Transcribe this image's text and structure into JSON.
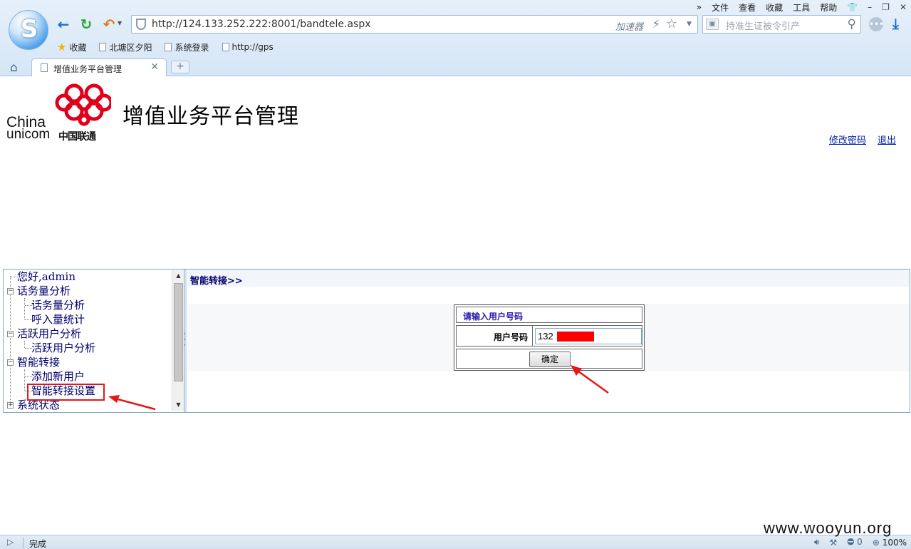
{
  "browser": {
    "menu": [
      "文件",
      "查看",
      "收藏",
      "工具",
      "帮助"
    ],
    "menu_expand": "»",
    "address_url": "http://124.133.252.222:8001/bandtele.aspx",
    "accelerator_label": "加速器",
    "search_placeholder": "持准生证被令引产",
    "favorites": [
      {
        "label": "收藏",
        "icon": "star-icon"
      },
      {
        "label": "北塘区夕阳",
        "icon": "page-icon"
      },
      {
        "label": "系统登录",
        "icon": "page-icon"
      },
      {
        "label": "http://gps",
        "icon": "page-icon"
      }
    ],
    "tab_title": "增值业务平台管理",
    "new_tab_label": "+",
    "status_text": "完成",
    "status_counter": "0",
    "zoom": "100%"
  },
  "header": {
    "logo_en_line1": "China",
    "logo_en_line2": "unicom",
    "logo_cn": "中国联通",
    "title": "增值业务平台管理",
    "change_password": "修改密码",
    "logout": "退出"
  },
  "tree": {
    "greeting": "您好,admin",
    "nodes": [
      {
        "label": "话务量分析",
        "type": "folder"
      },
      {
        "label": "话务量分析",
        "type": "leaf"
      },
      {
        "label": "呼入量统计",
        "type": "leaf"
      },
      {
        "label": "活跃用户分析",
        "type": "folder"
      },
      {
        "label": "活跃用户分析",
        "type": "leaf"
      },
      {
        "label": "智能转接",
        "type": "folder"
      },
      {
        "label": "添加新用户",
        "type": "leaf"
      },
      {
        "label": "智能转接设置",
        "type": "leaf",
        "highlighted": true
      },
      {
        "label": "系统状态",
        "type": "folder"
      }
    ]
  },
  "content": {
    "breadcrumb": "智能转接>>",
    "form_title": "请输入用户号码",
    "phone_label": "用户号码",
    "phone_value": "132",
    "confirm_label": "确定"
  },
  "watermark": "www.wooyun.org",
  "colors": {
    "annotation_red": "#e41818",
    "link_blue": "#0020a8",
    "tree_text": "#00006e"
  }
}
